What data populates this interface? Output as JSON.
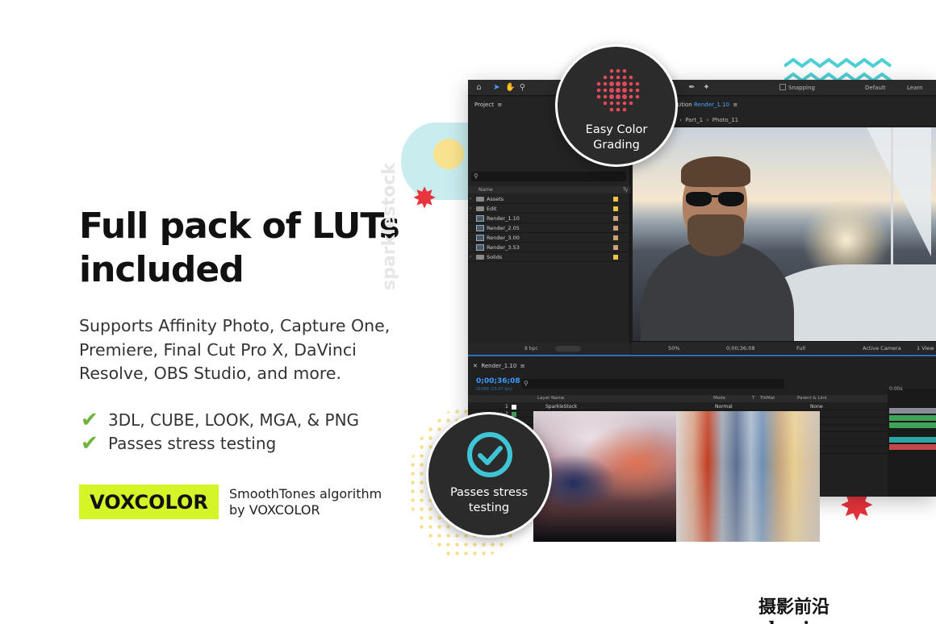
{
  "headline": "Full pack of LUTs included",
  "support_text": "Supports Affinity Photo, Capture One, Premiere, Final Cut Pro X, DaVinci Resolve, OBS Studio, and more.",
  "features": [
    "3DL, CUBE, LOOK, MGA, & PNG",
    "Passes stress testing"
  ],
  "brand": {
    "badge": "VOXCOLOR",
    "desc_line1": "SmoothTones algorithm",
    "desc_line2": "by VOXCOLOR"
  },
  "badges": {
    "grading_line1": "Easy Color",
    "grading_line2": "Grading",
    "stress_line1": "Passes stress",
    "stress_line2": "testing"
  },
  "decor_watermark": "sparklestock",
  "site_watermark": "摄影前沿sheyingzyz.com",
  "app": {
    "toolbar": {
      "snapping": "Snapping",
      "workspace_default": "Default",
      "workspace_learn": "Learn"
    },
    "project_title": "Project",
    "columns": {
      "name": "Name",
      "type": "Ty"
    },
    "project_items": [
      {
        "label": "Assets",
        "kind": "folder",
        "tag": "#e8c840"
      },
      {
        "label": "Edit",
        "kind": "folder",
        "tag": "#e8c840"
      },
      {
        "label": "Render_1.10",
        "kind": "comp",
        "tag": "#c9a27a"
      },
      {
        "label": "Render_2.05",
        "kind": "comp",
        "tag": "#c9a27a"
      },
      {
        "label": "Render_3.00",
        "kind": "comp",
        "tag": "#c9a27a"
      },
      {
        "label": "Render_3.53",
        "kind": "comp",
        "tag": "#c9a27a"
      },
      {
        "label": "Solids",
        "kind": "folder",
        "tag": "#e8c840"
      }
    ],
    "bit_depth": "8 bpc",
    "composition_label": "position",
    "composition_name": "Render_1.10",
    "crumbs": {
      "part": "Part_1",
      "photo": "Photo_11"
    },
    "viewer": {
      "zoom": "50%",
      "timecode": "0;00;36;08",
      "quality": "Full",
      "camera": "Active Camera",
      "views": "1 View"
    },
    "timeline_tab": "Render_1.10",
    "timecode": "0;00;36;08",
    "fps_info": "01088 (29.97 fps)",
    "layer_columns": {
      "layer_name": "Layer Name",
      "mode": "Mode",
      "t": "T",
      "trkmat": "TrkMat",
      "parent": "Parent & Link"
    },
    "layers": [
      {
        "num": "1",
        "name": "SparkleStock",
        "mode": "Normal",
        "parent": "None"
      },
      {
        "num": "2",
        "name": "",
        "mode": "",
        "parent": "ne"
      },
      {
        "num": "",
        "name": "",
        "mode": "",
        "parent": "ne"
      },
      {
        "num": "",
        "name": "",
        "mode": "",
        "parent": "ne"
      },
      {
        "num": "",
        "name": "",
        "mode": "",
        "parent": "ne"
      },
      {
        "num": "",
        "name": "",
        "mode": "",
        "parent": "ne"
      },
      {
        "num": "",
        "name": "",
        "mode": "",
        "parent": "ne"
      }
    ],
    "ruler_start": "0:00s"
  },
  "colors": {
    "accent_green": "#6fb43c",
    "brand_lime": "#d6f529",
    "badge_dark": "#2b2b2b",
    "grade_dots": "#e24a5a",
    "check_teal": "#3ec6d6",
    "timecode_blue": "#3b9bff"
  }
}
